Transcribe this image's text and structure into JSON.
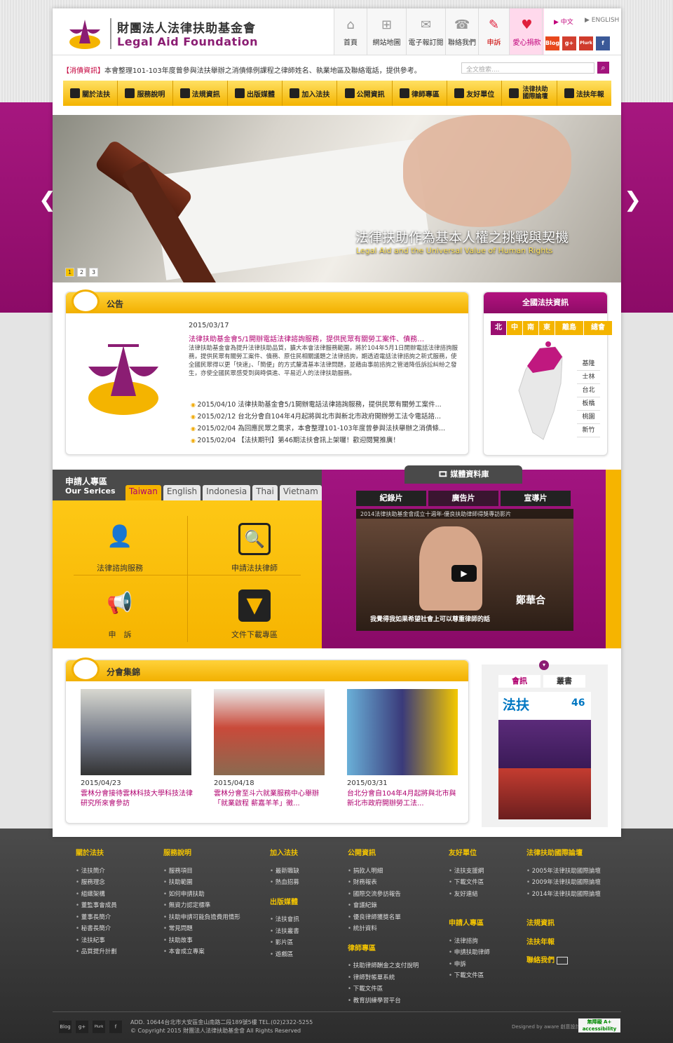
{
  "brand": {
    "zh": "財團法人法律扶助基金會",
    "en": "Legal Aid Foundation",
    "seal_text": "財團法人法律扶助基金會"
  },
  "topnav": [
    {
      "label": "首頁",
      "icon": "home-icon",
      "glyph": "⌂"
    },
    {
      "label": "網站地圖",
      "icon": "sitemap-icon",
      "glyph": "⊞"
    },
    {
      "label": "電子報訂閱",
      "icon": "mail-icon",
      "glyph": "✉"
    },
    {
      "label": "聯絡我們",
      "icon": "contact-icon",
      "glyph": "☎"
    },
    {
      "label": "申訴",
      "icon": "complaint-icon",
      "glyph": "✎"
    },
    {
      "label": "愛心捐款",
      "icon": "heart-icon",
      "glyph": "♥"
    }
  ],
  "lang": {
    "zh": "▶ 中文",
    "en": "▶ ENGLISH"
  },
  "social": [
    "Blog",
    "g+",
    "Plurk",
    "f"
  ],
  "ticker": {
    "tag": "【消債資訊】",
    "text": "本會整理101-103年度曾參與法扶舉辦之消債條例課程之律師姓名、執業地區及聯絡電話，提供參考。"
  },
  "search": {
    "placeholder": "全文檢索....",
    "button": "⌕"
  },
  "menu": [
    "關於法扶",
    "服務說明",
    "法規資訊",
    "出版媒體",
    "加入法扶",
    "公開資訊",
    "律師專區",
    "友好單位",
    "法律扶助國際論壇",
    "法扶年報"
  ],
  "banner": {
    "title_zh": "法律扶助作為基本人權之挑戰與契機",
    "title_en": "Legal Aid and the Universal Value of Human Rights",
    "pages": [
      "1",
      "2",
      "3"
    ],
    "prev": "❮",
    "next": "❯"
  },
  "notice": {
    "title": "公告",
    "date": "2015/03/17",
    "headline": "法律扶助基金會5/1開辦電話法律諮詢服務，提供民眾有關勞工案件、債務…",
    "body": "法律扶助基金會為提升法律扶助品質，擴大本會法律服務範圍，將於104年5月1日開辦電話法律諮詢服務，提供民眾有關勞工案件、債務、原住民相關議題之法律諮詢，期透過電話法律諮詢之新式服務，使全國民眾得以更「快速」、「簡便」的方式釐清基本法律問題，並藉由事前諮詢之管道降低訴訟糾紛之發生，亦使全國民眾感受到與時俱進、平易近人的法律扶助服務。",
    "items": [
      "2015/04/10 法律扶助基金會5/1開辦電話法律諮詢服務，提供民眾有關勞工案件...",
      "2015/02/12 台北分會自104年4月起將與北市與新北市政府開辦勞工法令電話諮...",
      "2015/02/04 為回應民眾之需求，本會整理101-103年度曾參與法扶舉辦之消債條...",
      "2015/02/04 【法扶期刊】第46期法扶會訊上架囉！歡迎閱覽推廣！"
    ]
  },
  "map": {
    "title": "全國法扶資訊",
    "regions": [
      "北",
      "中",
      "南",
      "東",
      "離島",
      "總會"
    ],
    "cities": [
      "基隆",
      "士林",
      "台北",
      "板橋",
      "桃園",
      "新竹"
    ]
  },
  "services": {
    "title_zh": "申請人專區",
    "title_en": "Our Serices",
    "tabs": [
      "Taiwan",
      "English",
      "Indonesia",
      "Thai",
      "Vietnam"
    ],
    "cells": [
      {
        "label": "法律諮詢服務",
        "icon": "person-icon",
        "glyph": "👤"
      },
      {
        "label": "申請法扶律師",
        "icon": "document-search-icon",
        "glyph": "🔍"
      },
      {
        "label": "申　訴",
        "icon": "megaphone-icon",
        "glyph": "📢"
      },
      {
        "label": "文件下載專區",
        "icon": "download-icon",
        "glyph": "▼"
      }
    ]
  },
  "media": {
    "title": "媒體資料庫",
    "tabs": [
      "紀錄片",
      "廣告片",
      "宣導片"
    ],
    "video_title": "2014法律扶助基金會成立十週年-優良扶助律師得獎專訪影片",
    "caption": "我覺得我如果希望社會上可以尊重律師的話",
    "name": "鄭華合",
    "play": "▶"
  },
  "branch": {
    "title": "分會集錦",
    "items": [
      {
        "date": "2015/04/23",
        "title": "雲林分會接待雲林科技大學科技法律研究所來會參訪"
      },
      {
        "date": "2015/04/18",
        "title": "雲林分會至斗六就業服務中心舉辦「就業啟程 薪嘉羊羊」徵..."
      },
      {
        "date": "2015/03/31",
        "title": "台北分會自104年4月起將與北市與新北市政府開辦勞工法..."
      }
    ]
  },
  "newsletter": {
    "tabs": [
      "會訊",
      "叢書"
    ],
    "cover_title": "法扶",
    "issue": "46"
  },
  "footer": {
    "cols": [
      {
        "h": "關於法扶",
        "items": [
          "法扶簡介",
          "服務理念",
          "組織架構",
          "董監事會成員",
          "董事長簡介",
          "秘書長簡介",
          "法扶紀事",
          "品質提升計劃"
        ]
      },
      {
        "h": "服務說明",
        "items": [
          "服務項目",
          "扶助範圍",
          "如何申請扶助",
          "無資力認定標準",
          "扶助申請可能負擔費用情形",
          "常見問題",
          "扶助故事",
          "本會成立專案"
        ]
      },
      {
        "h": "加入法扶",
        "items": [
          "最新職缺",
          "熱血招募"
        ],
        "h2": "出版媒體",
        "items2": [
          "法扶會訊",
          "法扶叢書",
          "影片區",
          "遊戲區"
        ]
      },
      {
        "h": "公開資訊",
        "items": [
          "捐款人明細",
          "財務報表",
          "國際交流參訪報告",
          "會議紀錄",
          "優良律師獲獎名單",
          "統計資料"
        ],
        "h2": "律師專區",
        "items2": [
          "扶助律師酬金之支付說明",
          "律師對帳單系統",
          "下載文件區",
          "教育訓練學習平台"
        ]
      },
      {
        "h": "友好單位",
        "items": [
          "法扶支援網",
          "下載文件區",
          "友好連結"
        ],
        "h2": "申請人專區",
        "items2": [
          "法律諮詢",
          "申請扶助律師",
          "申訴",
          "下載文件區"
        ]
      },
      {
        "h": "法律扶助國際論壇",
        "items": [
          "2005年法律扶助國際論壇",
          "2009年法律扶助國際論壇",
          "2014年法律扶助國際論壇"
        ],
        "h2": "法規資訊",
        "h3": "法扶年報",
        "h4": "聯絡我們"
      }
    ],
    "address": "ADD. 10644台北市大安區金山南路二段189號5樓  TEL.(02)2322-5255",
    "copyright": "© Copyright  2015   財團法人法律扶助基金會  All Rights Reserved",
    "designer": "Designed by aware 創意設計",
    "accessibility": "無障礙 A+ accessibility"
  }
}
